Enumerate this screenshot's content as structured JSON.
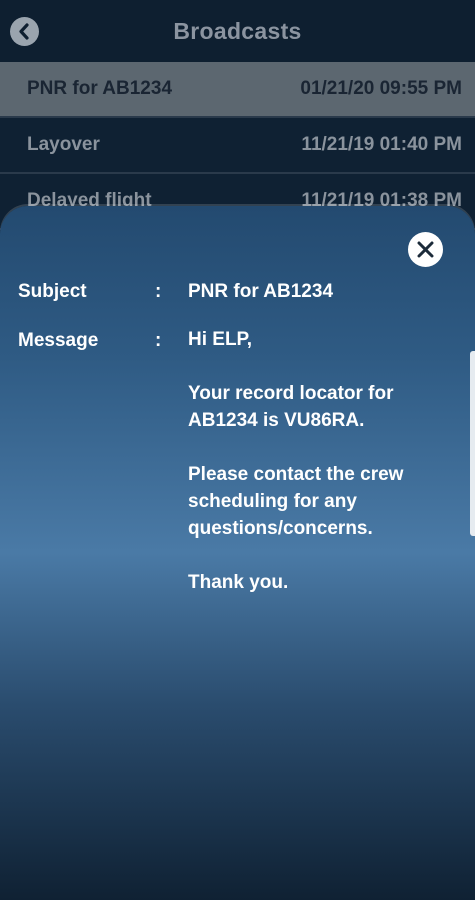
{
  "header": {
    "title": "Broadcasts"
  },
  "broadcasts": [
    {
      "subject": "PNR for AB1234",
      "datetime": "01/21/20 09:55 PM"
    },
    {
      "subject": "Layover",
      "datetime": "11/21/19 01:40 PM"
    },
    {
      "subject": "Delayed flight",
      "datetime": "11/21/19 01:38 PM"
    }
  ],
  "detail": {
    "subject_label": "Subject",
    "message_label": "Message",
    "separator": ":",
    "subject_value": "PNR for AB1234",
    "message_lines": [
      "Hi ELP,",
      "Your record locator for AB1234 is VU86RA.",
      "Please contact the crew scheduling for any questions/concerns.",
      "Thank you."
    ]
  },
  "colors": {
    "header_bg": "#0e1f30",
    "selected_row_bg": "#5c6770",
    "modal_gradient_top": "#234a70",
    "modal_gradient_mid": "#4a7aa6",
    "text_primary": "#ffffff"
  },
  "icons": {
    "back": "chevron-left-icon",
    "close": "close-icon"
  }
}
